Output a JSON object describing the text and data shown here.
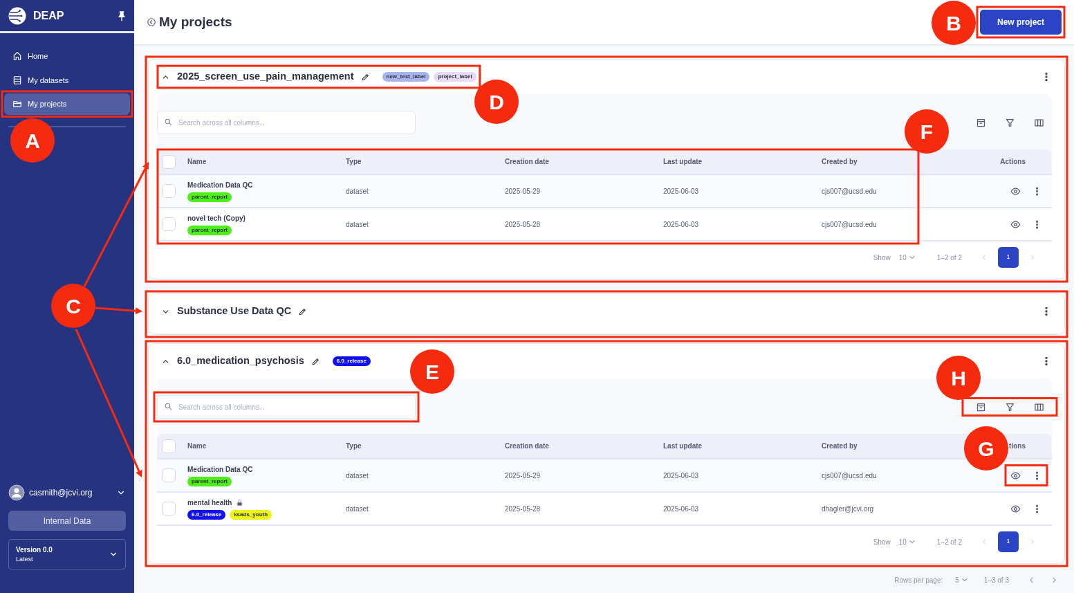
{
  "sidebar": {
    "brand": "DEAP",
    "items": [
      {
        "label": "Home",
        "selected": false
      },
      {
        "label": "My datasets",
        "selected": false
      },
      {
        "label": "My projects",
        "selected": true
      }
    ],
    "user": {
      "email": "casmith@jcvi.org"
    },
    "data_button": "Internal Data",
    "version": {
      "title": "Version 0.0",
      "subtitle": "Latest"
    }
  },
  "header": {
    "title": "My projects",
    "new_button": "New project"
  },
  "projects": [
    {
      "name": "2025_screen_use_pain_management",
      "expanded": true,
      "labels": [
        {
          "text": "new_test_label",
          "color": "#aab4ec"
        },
        {
          "text": "project_label",
          "color": "#e8daf4"
        }
      ],
      "table": {
        "search_placeholder": "Search across all columns...",
        "all_checked": false,
        "columns": [
          "Name",
          "Type",
          "Creation date",
          "Last update",
          "Created by",
          "Actions"
        ],
        "rows": [
          {
            "name": "Medication Data QC",
            "locked": false,
            "checked": false,
            "tags": [
              {
                "text": "parent_report",
                "color": "#4cf014"
              }
            ],
            "type": "dataset",
            "created": "2025-05-29",
            "updated": "2025-06-03",
            "created_by": "cjs007@ucsd.edu"
          },
          {
            "name": "novel tech (Copy)",
            "locked": false,
            "checked": false,
            "tags": [
              {
                "text": "parent_report",
                "color": "#4cf014"
              }
            ],
            "type": "dataset",
            "created": "2025-05-28",
            "updated": "2025-06-03",
            "created_by": "cjs007@ucsd.edu"
          }
        ],
        "pagination": {
          "show_label": "Show",
          "page_size": "10",
          "range": "1–2 of 2",
          "page": "1"
        }
      }
    },
    {
      "name": "Substance Use Data QC",
      "expanded": false
    },
    {
      "name": "6.0_medication_psychosis",
      "expanded": true,
      "labels": [
        {
          "text": "6.0_release",
          "color": "#1010f0"
        }
      ],
      "table": {
        "search_placeholder": "Search across all columns...",
        "all_checked": false,
        "columns": [
          "Name",
          "Type",
          "Creation date",
          "Last update",
          "Created by",
          "tions"
        ],
        "rows": [
          {
            "name": "Medication Data QC",
            "locked": false,
            "checked": false,
            "tags": [
              {
                "text": "parent_report",
                "color": "#4cf014"
              }
            ],
            "type": "dataset",
            "created": "2025-05-29",
            "updated": "2025-06-03",
            "created_by": "cjs007@ucsd.edu"
          },
          {
            "name": "mental health",
            "locked": true,
            "checked": false,
            "tags": [
              {
                "text": "6.0_release",
                "color": "#1010f0"
              },
              {
                "text": "ksads_youth",
                "color": "#eef515"
              }
            ],
            "type": "dataset",
            "created": "2025-05-28",
            "updated": "2025-06-03",
            "created_by": "dhagler@jcvi.org"
          }
        ],
        "pagination": {
          "show_label": "Show",
          "page_size": "10",
          "range": "1–2 of 2",
          "page": "1"
        }
      }
    }
  ],
  "footer": {
    "rows_label": "Rows per page:",
    "rows_value": "5",
    "range": "1–3 of 3"
  },
  "annotations": [
    {
      "letter": "A"
    },
    {
      "letter": "B"
    },
    {
      "letter": "C"
    },
    {
      "letter": "D"
    },
    {
      "letter": "E"
    },
    {
      "letter": "F"
    },
    {
      "letter": "G"
    },
    {
      "letter": "H"
    }
  ]
}
